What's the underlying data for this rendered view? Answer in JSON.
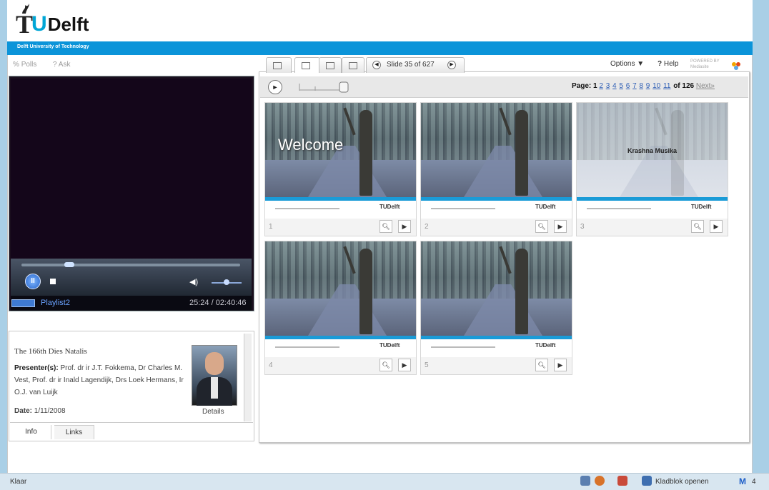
{
  "header": {
    "logo_t": "T",
    "logo_u": "U",
    "logo_delft": "Delft",
    "subtitle": "Delft University of Technology"
  },
  "left_tools": {
    "polls": "Polls",
    "ask": "Ask"
  },
  "player": {
    "playlist_label": "Playlist2",
    "time": "25:24 / 02:40:46",
    "play_glyph": "II",
    "seek_position": 0.22,
    "volume_level": 0.5
  },
  "info": {
    "title": "The 166th Dies Natalis",
    "presenters_label": "Presenter(s):",
    "presenters_value": "Prof. dr ir J.T. Fokkema, Dr Charles M. Vest, Prof. dr ir Inald Lagendijk, Drs Loek Hermans, Ir O.J. van Luijk",
    "date_label": "Date:",
    "date_value": "1/11/2008",
    "details_link": "Details",
    "tabs": [
      "Info",
      "Links"
    ]
  },
  "viewer": {
    "slide_nav": "Slide 35 of 627",
    "options": "Options",
    "help": "Help",
    "powered_by": "POWERED BY Mediasite",
    "pager_label": "Page:",
    "pages": [
      "1",
      "2",
      "3",
      "4",
      "5",
      "6",
      "7",
      "8",
      "9",
      "10",
      "11"
    ],
    "current_page": "1",
    "pager_total": "of 126",
    "next": "Next»"
  },
  "thumbnails": [
    {
      "num": "1",
      "title": "Welcome"
    },
    {
      "num": "2",
      "title": ""
    },
    {
      "num": "3",
      "title": "Krashna Musika"
    },
    {
      "num": "4",
      "title": ""
    },
    {
      "num": "5",
      "title": ""
    }
  ],
  "slide_logo_text": "TUDelft",
  "statusbar": {
    "status": "Klaar",
    "kladblok": "Kladblok openen",
    "gmail_count": "4"
  },
  "colors": {
    "brand_blue": "#0b94d9",
    "accent_cyan": "#00a6d6",
    "link": "#2f5fb5"
  }
}
